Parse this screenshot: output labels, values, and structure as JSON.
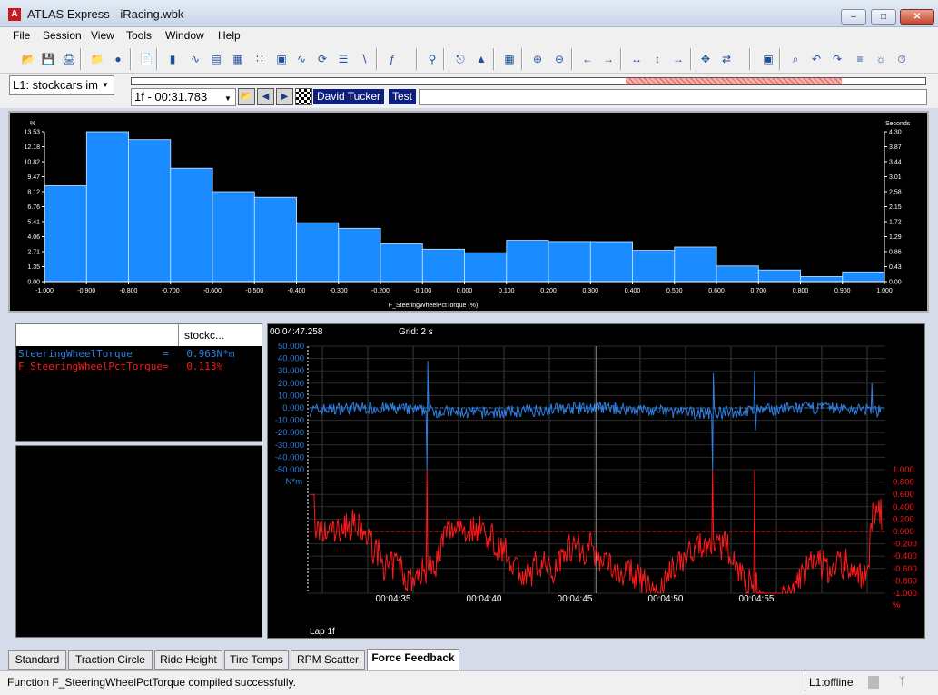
{
  "window": {
    "title": "ATLAS Express - iRacing.wbk",
    "icon": "A"
  },
  "menu": [
    "File",
    "Session",
    "View",
    "Tools",
    "Window",
    "Help"
  ],
  "toolbar_icons": [
    "open-icon",
    "save-icon",
    "print-icon",
    "open-session-icon",
    "record-icon",
    "page-icon",
    "bars-icon",
    "waveform-icon",
    "histogram-icon",
    "grid-icon",
    "scatter-icon",
    "map-icon",
    "sine-icon",
    "loop-icon",
    "lap-compare-icon",
    "line-icon",
    "function-icon",
    "antenna-icon",
    "cursor-icon",
    "marker-icon",
    "table-icon",
    "zoom-in-icon",
    "zoom-out-icon",
    "pan-left-icon",
    "pan-right-icon",
    "fit-icon",
    "expand-icon",
    "collapse-icon",
    "move-icon",
    "swap-icon",
    "properties-icon",
    "zoom-time-icon",
    "undo-icon",
    "redo-icon",
    "align-icon",
    "light-icon",
    "timer-icon"
  ],
  "lap": {
    "session_label": "L1: stockcars im",
    "lap_time": "1f - 00:31.783",
    "driver": "David Tucker",
    "event": "Test"
  },
  "histogram": {
    "left_unit": "%",
    "right_unit": "Seconds",
    "xlabel": "F_SteeringWheelPctTorque (%)"
  },
  "chart_data": [
    {
      "type": "bar",
      "title": "",
      "xlabel": "F_SteeringWheelPctTorque (%)",
      "ylabel": "%",
      "y2label": "Seconds",
      "categories": [
        "-1.000",
        "-0.900",
        "-0.800",
        "-0.700",
        "-0.600",
        "-0.500",
        "-0.400",
        "-0.300",
        "-0.200",
        "-0.100",
        "0.000",
        "0.100",
        "0.200",
        "0.300",
        "0.400",
        "0.500",
        "0.600",
        "0.700",
        "0.800",
        "0.900"
      ],
      "values": [
        8.65,
        13.53,
        12.82,
        10.23,
        8.12,
        7.61,
        5.31,
        4.81,
        3.42,
        2.93,
        2.61,
        3.72,
        3.62,
        3.61,
        2.82,
        3.12,
        1.41,
        1.05,
        0.45,
        0.88
      ],
      "xlim": [
        -1.0,
        1.0
      ],
      "ylim": [
        0,
        13.53
      ],
      "y2lim": [
        0,
        4.3
      ],
      "yticks": [
        "0.00",
        "1.35",
        "2.71",
        "4.06",
        "5.41",
        "6.76",
        "8.12",
        "9.47",
        "10.82",
        "12.18",
        "13.53"
      ],
      "y2ticks": [
        "0.00",
        "0.43",
        "0.86",
        "1.29",
        "1.72",
        "2.15",
        "2.58",
        "3.01",
        "3.44",
        "3.87",
        "4.30"
      ],
      "xticks": [
        "-1.000",
        "-0.900",
        "-0.800",
        "-0.700",
        "-0.600",
        "-0.500",
        "-0.400",
        "-0.300",
        "-0.200",
        "-0.100",
        "0.000",
        "0.100",
        "0.200",
        "0.300",
        "0.400",
        "0.500",
        "0.600",
        "0.700",
        "0.800",
        "0.900",
        "1.000"
      ],
      "bar_color": "#1a8cff",
      "grid": false
    },
    {
      "type": "line",
      "title": "",
      "cursor_time": "00:04:47.258",
      "grid_label": "Grid: 2 s",
      "lap_label": "Lap 1f",
      "xticks": [
        "00:04:35",
        "00:04:40",
        "00:04:45",
        "00:04:50",
        "00:04:55"
      ],
      "series": [
        {
          "name": "SteeringWheelTorque",
          "unit": "N*m",
          "color": "#2f7fe0",
          "ylim": [
            -50,
            50
          ],
          "yticks": [
            "50.000",
            "40.000",
            "30.000",
            "20.000",
            "10.000",
            "0.000",
            "-10.000",
            "-20.000",
            "-30.000",
            "-40.000",
            "-50.000"
          ]
        },
        {
          "name": "F_SteeringWheelPctTorque",
          "unit": "%",
          "color": "#ff1a1a",
          "ylim": [
            -1,
            1
          ],
          "yticks": [
            "1.000",
            "0.800",
            "0.600",
            "0.400",
            "0.200",
            "0.000",
            "-0.200",
            "-0.400",
            "-0.600",
            "-0.800",
            "-1.000"
          ]
        }
      ],
      "grid": true
    }
  ],
  "values_grid": {
    "column_header": "stockc...",
    "rows": [
      {
        "text": "SteeringWheelTorque     =   0.963N*m",
        "color": "#2f7fe0"
      },
      {
        "text": "F_SteeringWheelPctTorque=   0.113%",
        "color": "#ff1a1a"
      }
    ]
  },
  "tabs": [
    "Standard",
    "Traction Circle",
    "Ride Height",
    "Tire Temps",
    "RPM Scatter",
    "Force Feedback"
  ],
  "active_tab": "Force Feedback",
  "status": {
    "message": "Function F_SteeringWheelPctTorque compiled successfully.",
    "state": "L1:offline"
  }
}
